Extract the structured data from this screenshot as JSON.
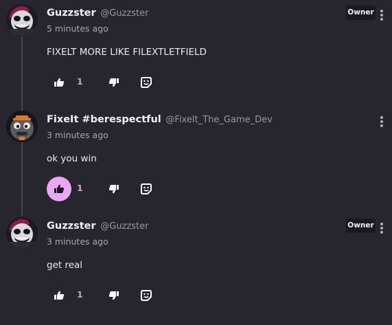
{
  "comments": [
    {
      "author": "Guzzster",
      "handle": "@Guzzster",
      "time": "5 minutes ago",
      "badge": "Owner",
      "text": "FIXELT MORE LIKE FILEXTLETFIELD",
      "likes": "1",
      "liked": false
    },
    {
      "author": "FixeIt #berespectful",
      "handle": "@FixeIt_The_Game_Dev",
      "time": "3 minutes ago",
      "badge": "",
      "text": "ok you win",
      "likes": "1",
      "liked": true
    },
    {
      "author": "Guzzster",
      "handle": "@Guzzster",
      "time": "3 minutes ago",
      "badge": "Owner",
      "text": "get real",
      "likes": "1",
      "liked": false
    }
  ],
  "icons": {
    "like": "thumbs-up-icon",
    "dislike": "thumbs-down-icon",
    "react": "add-reaction-icon",
    "more": "more-vertical-icon"
  },
  "colors": {
    "background": "#27252d",
    "accent": "#e9a7f0",
    "accent_text": "#e39bec",
    "badge_bg": "#1a1920"
  }
}
